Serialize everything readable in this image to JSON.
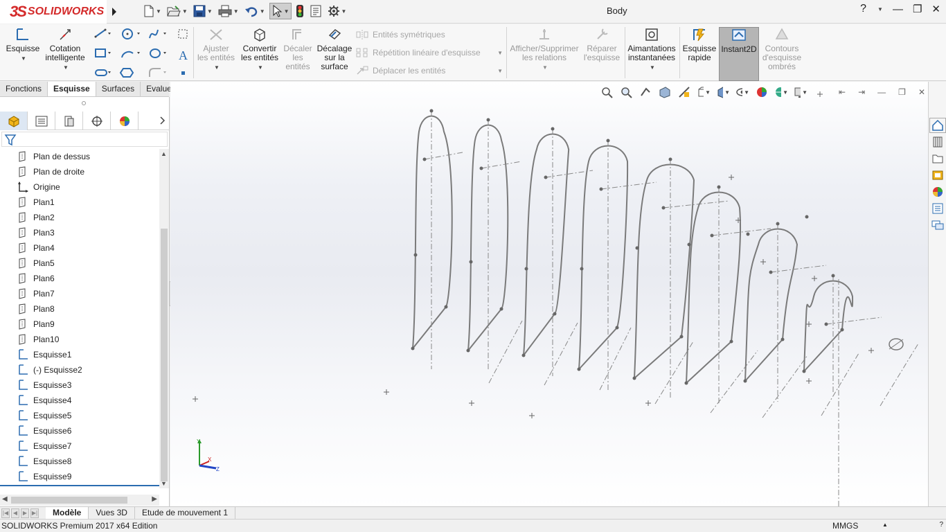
{
  "app": {
    "logo_mark": "3S",
    "logo_text": "SOLIDWORKS",
    "document_title": "Body",
    "help": "?"
  },
  "quick_access": {
    "icons": [
      "new-document-icon",
      "open-icon",
      "save-icon",
      "print-icon",
      "undo-icon",
      "select-icon",
      "rebuild-icon",
      "file-properties-icon",
      "options-icon"
    ]
  },
  "command_manager": {
    "esquisse": "Esquisse",
    "cotation": "Cotation intelligente",
    "ajuster": "Ajuster les entités",
    "convertir": "Convertir les entités",
    "decaler": "Décaler les entités",
    "decalage_surface": "Décalage sur la surface",
    "entites_symetriques": "Entités symétriques",
    "repetition_lineaire": "Répétition linéaire d'esquisse",
    "deplacer": "Déplacer les entités",
    "afficher_relations": "Afficher/Supprimer les relations",
    "reparer": "Réparer l'esquisse",
    "aimantations": "Aimantations instantanées",
    "esquisse_rapide": "Esquisse rapide",
    "instant2d": "Instant2D",
    "contours": "Contours d'esquisse ombrés"
  },
  "cm_tabs": [
    "Fonctions",
    "Esquisse",
    "Surfaces",
    "Evaluer"
  ],
  "feature_tree": [
    {
      "label": "Plan de dessus",
      "type": "plane"
    },
    {
      "label": "Plan de droite",
      "type": "plane"
    },
    {
      "label": "Origine",
      "type": "origin"
    },
    {
      "label": "Plan1",
      "type": "plane"
    },
    {
      "label": "Plan2",
      "type": "plane"
    },
    {
      "label": "Plan3",
      "type": "plane"
    },
    {
      "label": "Plan4",
      "type": "plane"
    },
    {
      "label": "Plan5",
      "type": "plane"
    },
    {
      "label": "Plan6",
      "type": "plane"
    },
    {
      "label": "Plan7",
      "type": "plane"
    },
    {
      "label": "Plan8",
      "type": "plane"
    },
    {
      "label": "Plan9",
      "type": "plane"
    },
    {
      "label": "Plan10",
      "type": "plane"
    },
    {
      "label": "Esquisse1",
      "type": "sketch"
    },
    {
      "label": "(-) Esquisse2",
      "type": "sketch"
    },
    {
      "label": "Esquisse3",
      "type": "sketch"
    },
    {
      "label": "Esquisse4",
      "type": "sketch"
    },
    {
      "label": "Esquisse5",
      "type": "sketch"
    },
    {
      "label": "Esquisse6",
      "type": "sketch"
    },
    {
      "label": "Esquisse7",
      "type": "sketch"
    },
    {
      "label": "Esquisse8",
      "type": "sketch"
    },
    {
      "label": "Esquisse9",
      "type": "sketch"
    }
  ],
  "bottom_tabs": [
    "Modèle",
    "Vues 3D",
    "Etude de mouvement 1"
  ],
  "status": {
    "text": "SOLIDWORKS Premium 2017 x64 Edition",
    "units": "MMGS"
  },
  "triad": {
    "x": "X",
    "y": "Y",
    "z": "Z"
  },
  "colors": {
    "brand": "#d42a2a",
    "sketch": "#7a7a7a",
    "accent": "#2b6cb0"
  }
}
